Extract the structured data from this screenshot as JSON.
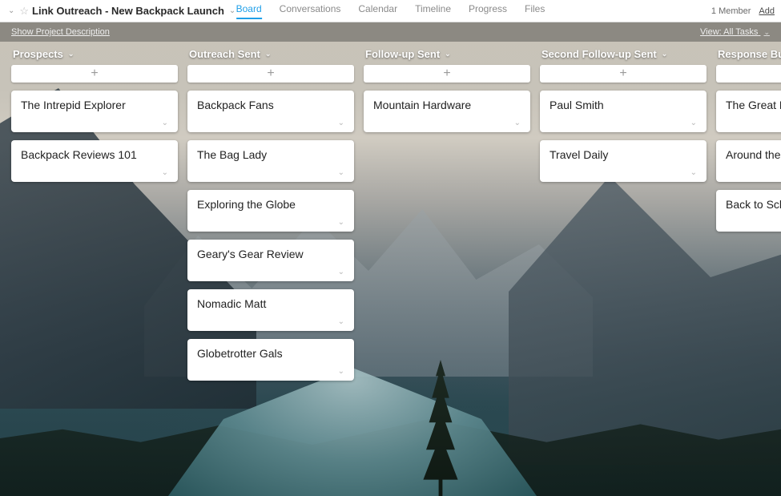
{
  "project": {
    "title": "Link Outreach - New Backpack Launch",
    "show_description_label": "Show Project Description",
    "members_label": "1 Member",
    "add_label": "Add"
  },
  "nav": {
    "tabs": [
      "Board",
      "Conversations",
      "Calendar",
      "Timeline",
      "Progress",
      "Files"
    ],
    "active_index": 0
  },
  "view": {
    "label": "View: All Tasks"
  },
  "columns": [
    {
      "name": "Prospects",
      "cards": [
        "The Intrepid Explorer",
        "Backpack Reviews 101"
      ]
    },
    {
      "name": "Outreach Sent",
      "cards": [
        "Backpack Fans",
        "The Bag Lady",
        "Exploring the Globe",
        "Geary's Gear Review",
        "Nomadic Matt",
        "Globetrotter Gals"
      ]
    },
    {
      "name": "Follow-up Sent",
      "cards": [
        "Mountain Hardware"
      ]
    },
    {
      "name": "Second Follow-up Sent",
      "cards": [
        "Paul Smith",
        "Travel Daily"
      ]
    },
    {
      "name": "Response But",
      "cards": [
        "The Great Es",
        "Around the W",
        "Back to Scho"
      ]
    }
  ],
  "glyphs": {
    "chev_down": "⌄",
    "star": "☆",
    "plus": "+"
  }
}
